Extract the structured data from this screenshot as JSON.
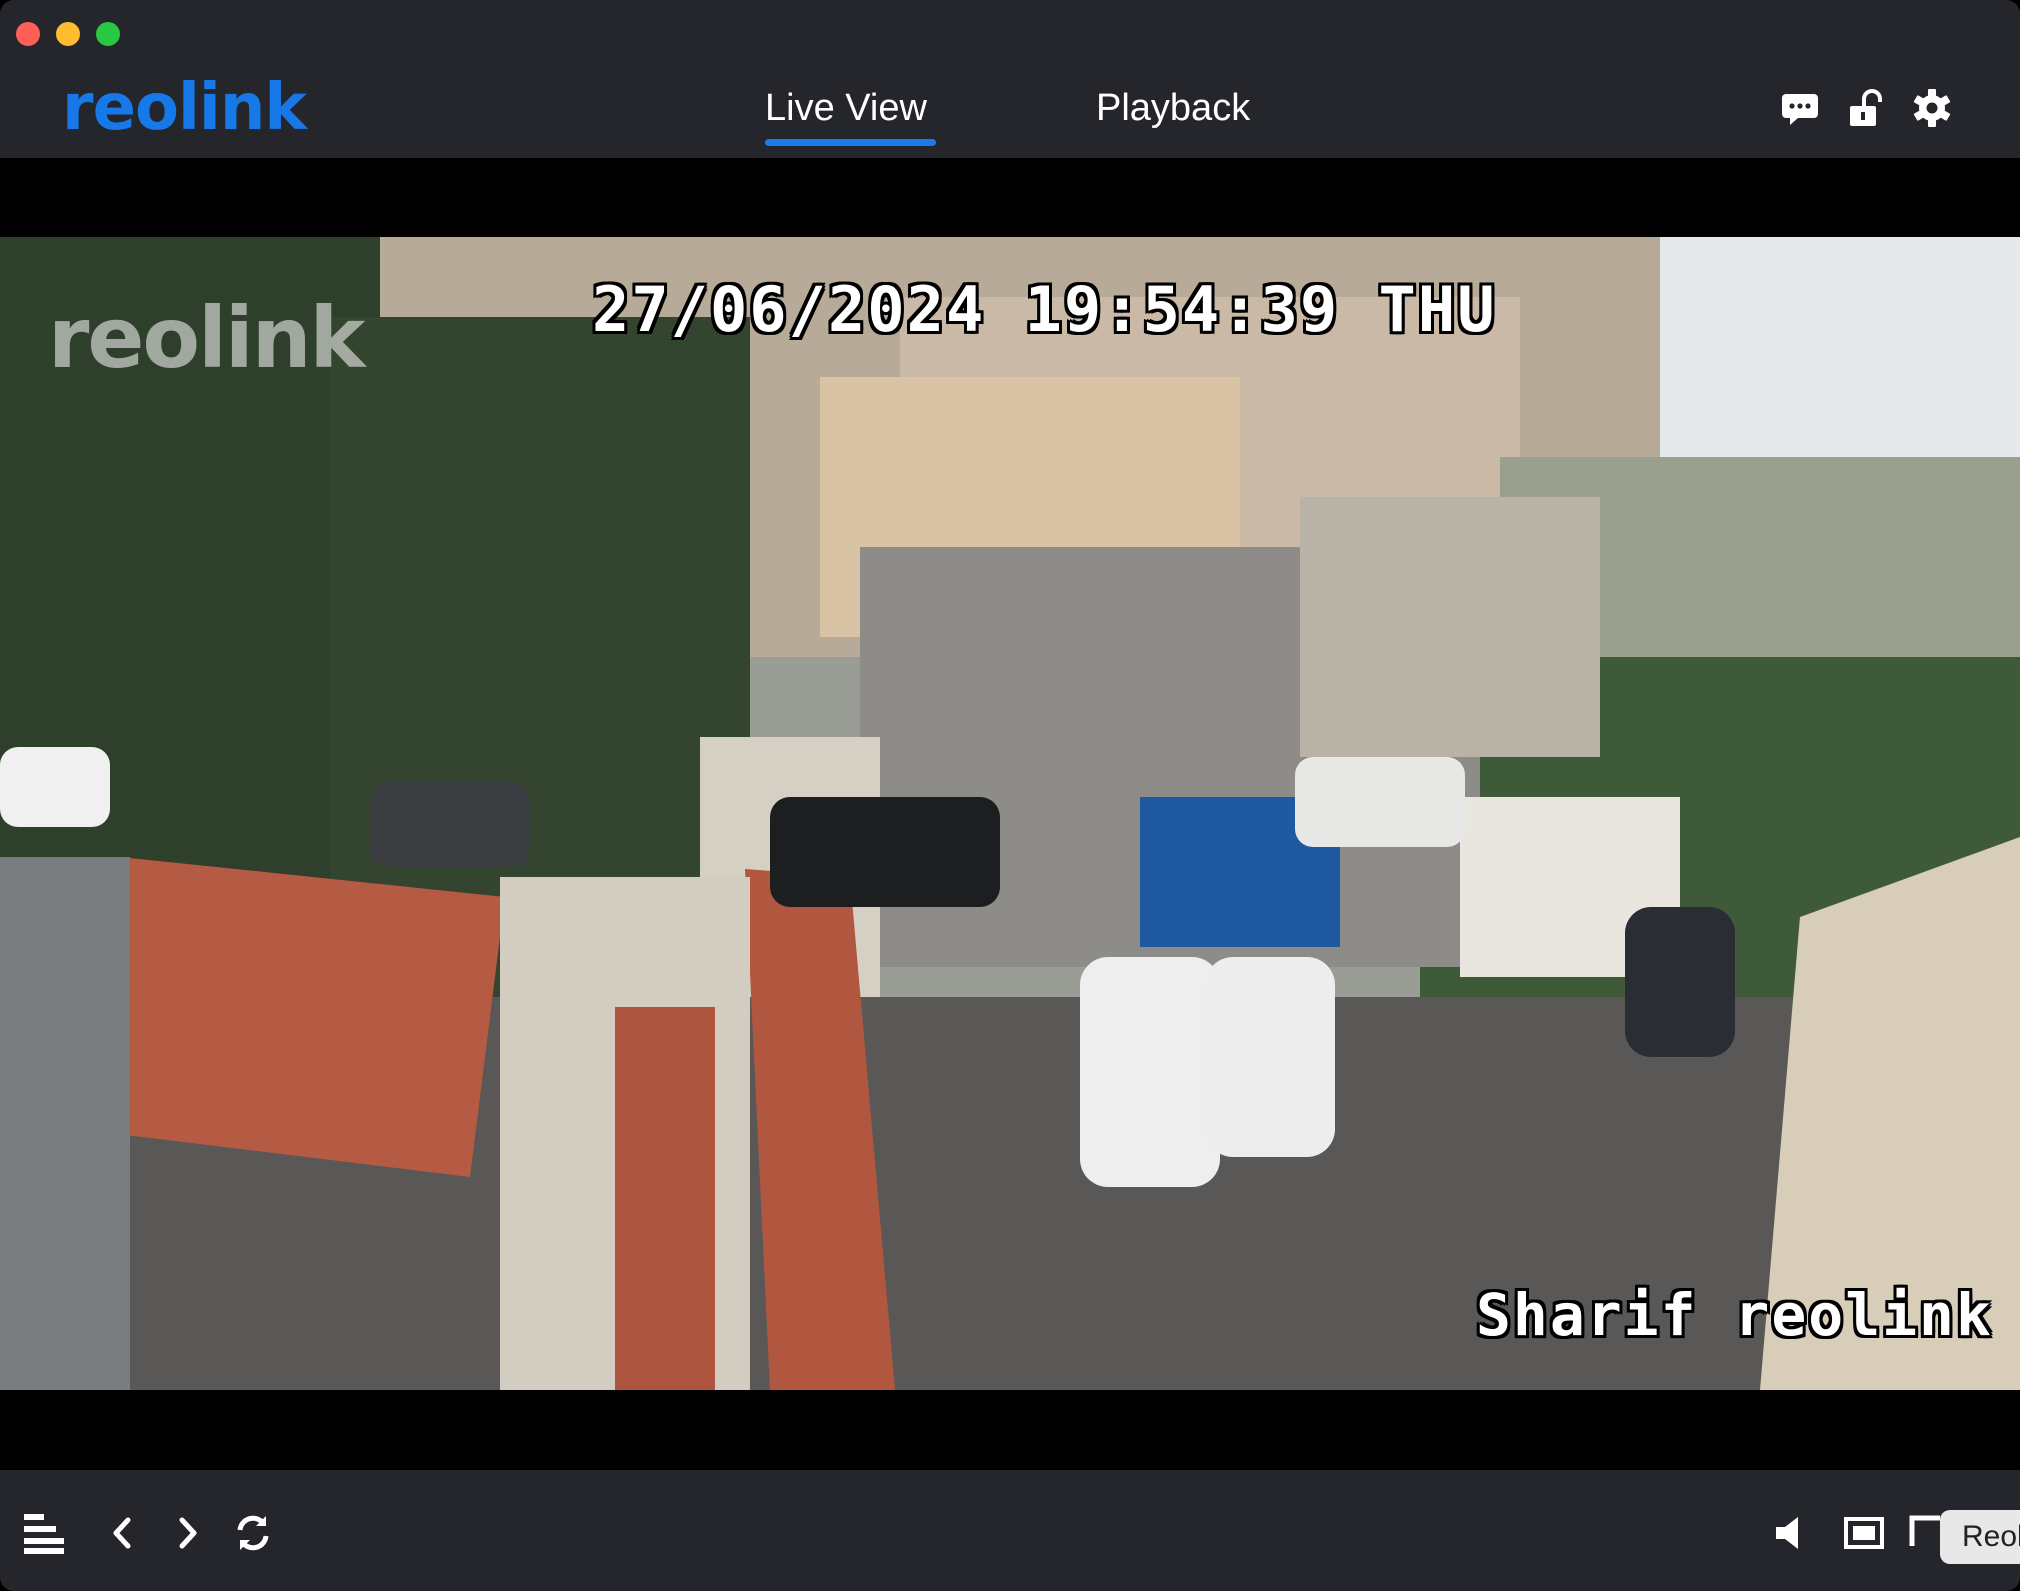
{
  "window": {
    "traffic_lights": [
      "close",
      "minimize",
      "zoom"
    ]
  },
  "header": {
    "logo_text": "reolink",
    "tabs": [
      {
        "label": "Live View",
        "active": true
      },
      {
        "label": "Playback",
        "active": false
      }
    ],
    "icons": [
      "chat-icon",
      "lock-icon",
      "gear-icon"
    ]
  },
  "video": {
    "osd_datetime": "27/06/2024 19:54:39 THU",
    "osd_camera_name": "Sharif reolink",
    "watermark": "reolink"
  },
  "toolbar": {
    "left_icons": [
      "menu-icon",
      "chevron-left-icon",
      "chevron-right-icon",
      "refresh-icon"
    ],
    "right_icons": [
      "speaker-icon",
      "screen-icon",
      "expand-icon"
    ],
    "tooltip_text": "Reol"
  },
  "colors": {
    "accent": "#1a7ae8",
    "background": "#24262b"
  }
}
